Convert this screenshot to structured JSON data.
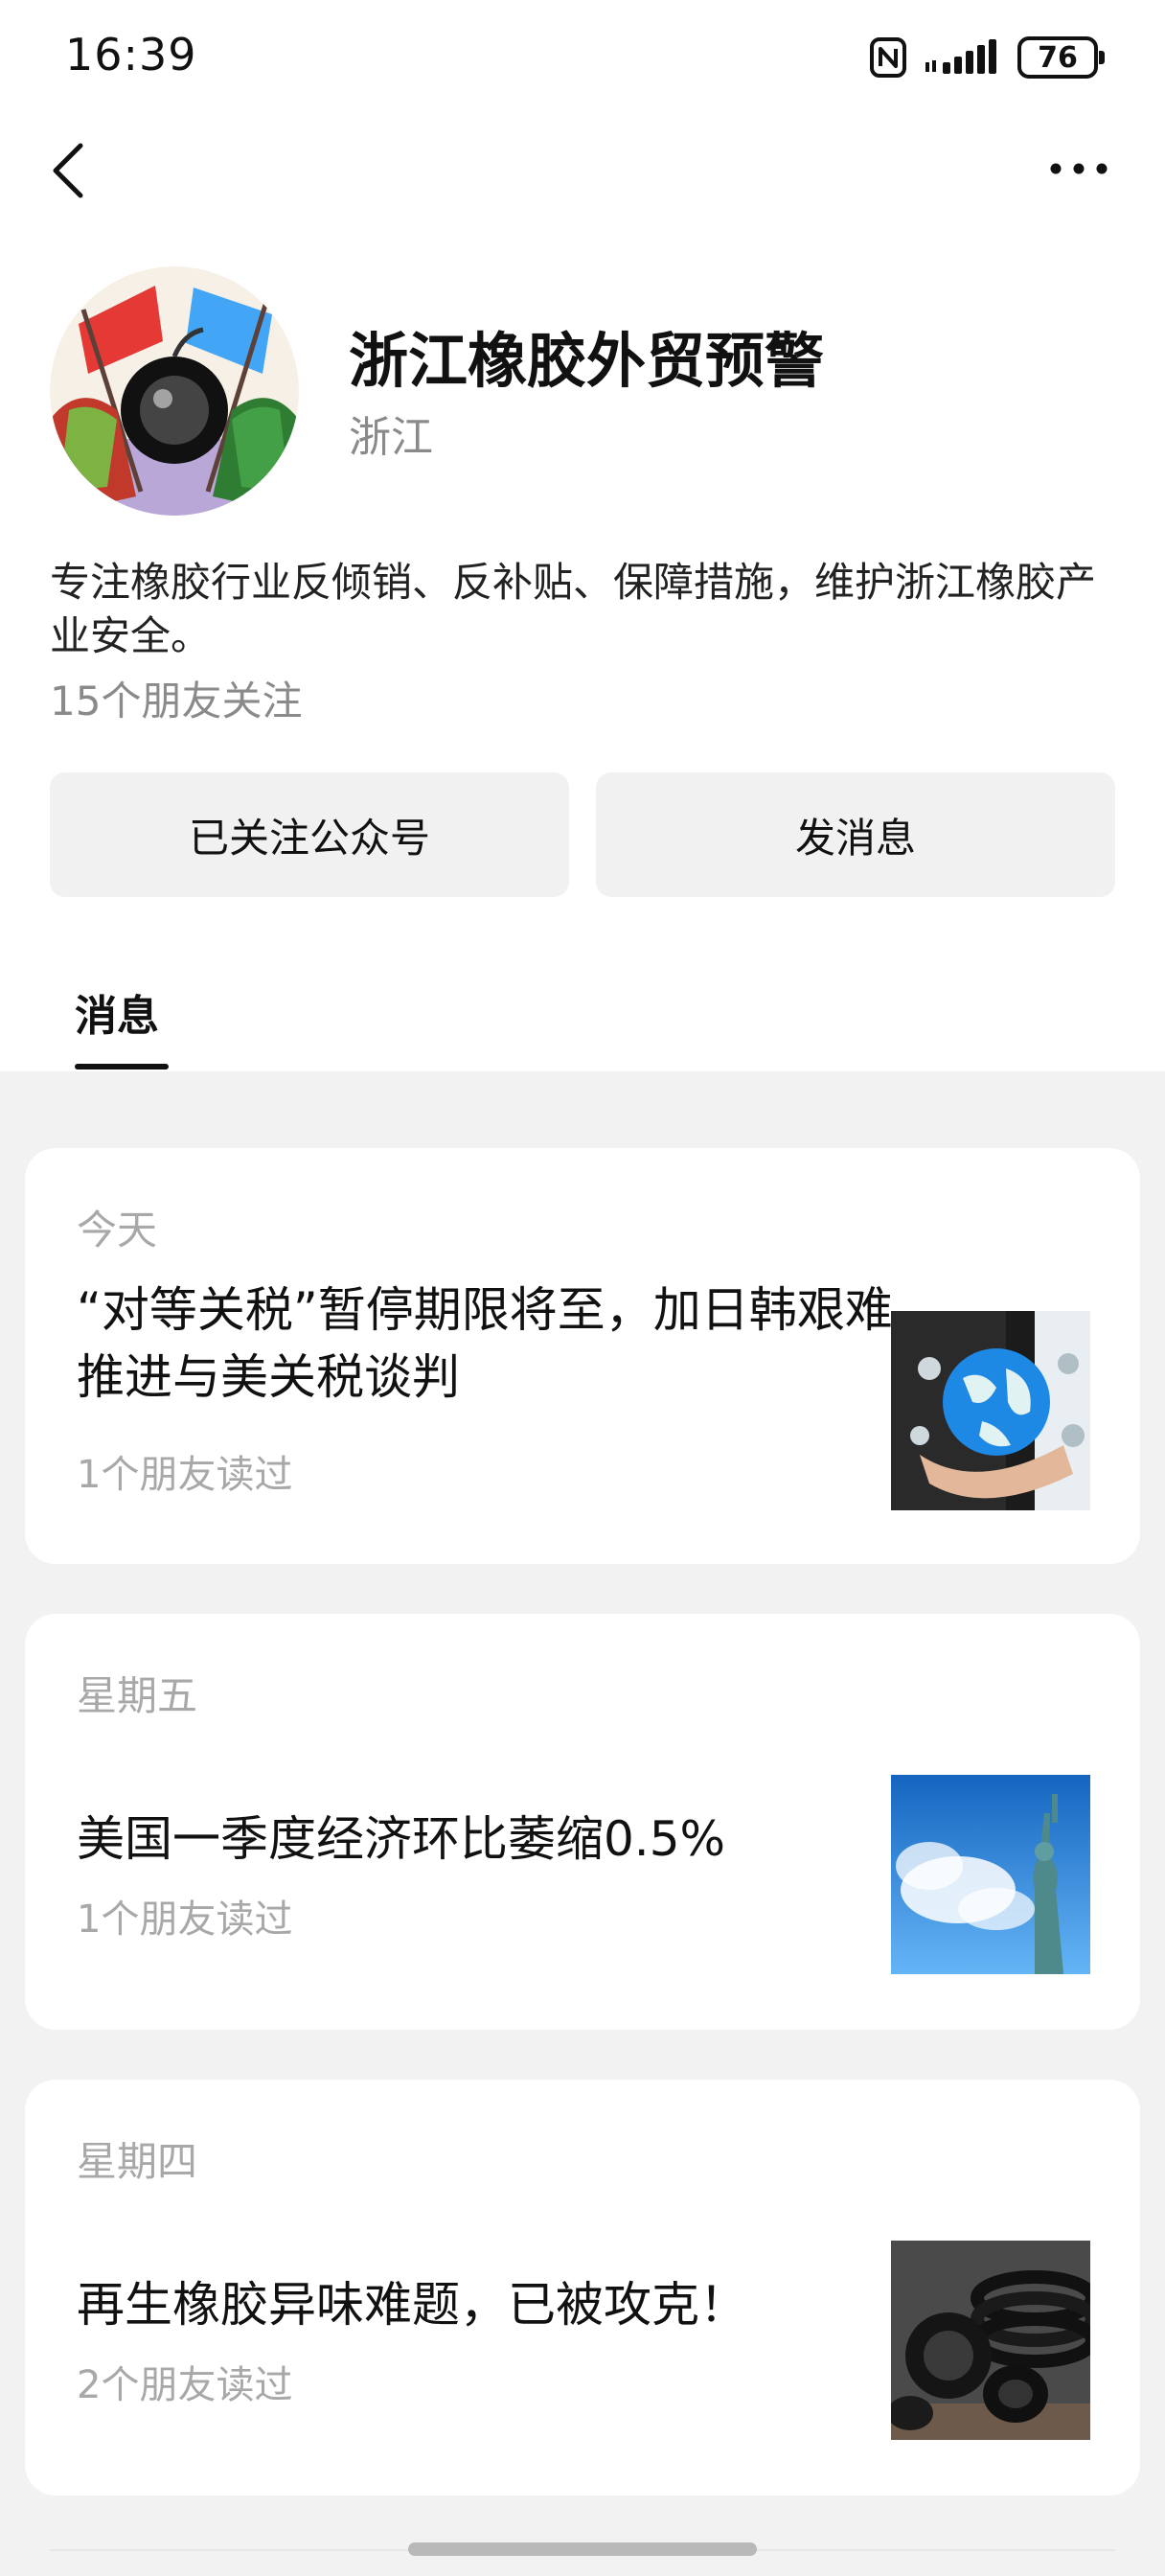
{
  "status_bar": {
    "time": "16:39",
    "battery": "76",
    "icons": [
      "nfc-icon",
      "signal-icon",
      "battery-icon"
    ]
  },
  "nav": {
    "icons": [
      "back-icon",
      "more-icon"
    ]
  },
  "profile": {
    "name": "浙江橡胶外贸预警",
    "region": "浙江",
    "description": "专注橡胶行业反倾销、反补贴、保障措施，维护浙江橡胶产业安全。",
    "friends_follow": "15个朋友关注",
    "avatar_flag_left": "中国",
    "avatar_flag_right": "美国"
  },
  "actions": {
    "follow_label": "已关注公众号",
    "message_label": "发消息"
  },
  "tabs": [
    {
      "label": "消息",
      "active": true
    }
  ],
  "articles": [
    {
      "date": "今天",
      "title": "“对等关税”暂停期限将至，加日韩艰难推进与美关税谈判",
      "reads": "1个朋友读过",
      "thumb_icon": "globe-in-hand-icon"
    },
    {
      "date": "星期五",
      "title": "美国一季度经济环比萎缩0.5%",
      "reads": "1个朋友读过",
      "thumb_icon": "statue-of-liberty-icon"
    },
    {
      "date": "星期四",
      "title": "再生橡胶异味难题，已被攻克！",
      "reads": "2个朋友读过",
      "thumb_icon": "rubber-hose-icon"
    }
  ],
  "colors": {
    "background": "#ffffff",
    "feed_background": "#f2f2f2",
    "button_background": "#f1f1f1",
    "secondary_text": "#a8a8a8"
  }
}
